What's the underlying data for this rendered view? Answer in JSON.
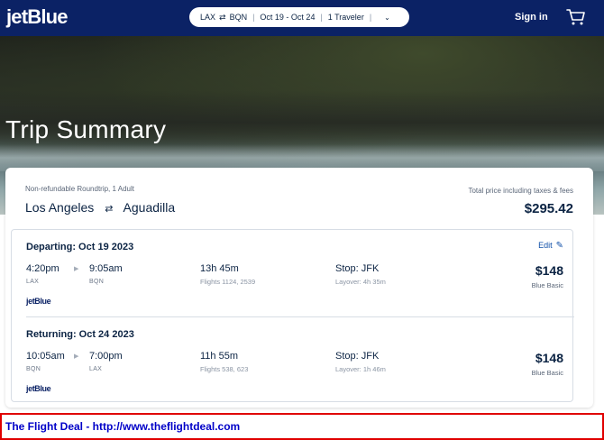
{
  "header": {
    "logo": "jetBlue",
    "search": {
      "origin": "LAX",
      "destination": "BQN",
      "dates": "Oct 19 - Oct 24",
      "travelers": "1 Traveler"
    },
    "signin_label": "Sign in"
  },
  "hero": {
    "title": "Trip Summary"
  },
  "summary": {
    "fare_type": "Non-refundable Roundtrip, 1 Adult",
    "origin_city": "Los Angeles",
    "destination_city": "Aguadilla",
    "total_label": "Total price including taxes & fees",
    "total_price": "$295.42"
  },
  "legs": [
    {
      "title": "Departing: Oct 19 2023",
      "edit_label": "Edit",
      "depart_time": "4:20pm",
      "depart_code": "LAX",
      "arrive_time": "9:05am",
      "arrive_code": "BQN",
      "duration": "13h 45m",
      "flights": "Flights 1124, 2539",
      "stop": "Stop: JFK",
      "layover": "Layover: 4h 35m",
      "price": "$148",
      "fare_class": "Blue Basic",
      "airline_logo": "jetBlue"
    },
    {
      "title": "Returning: Oct 24 2023",
      "depart_time": "10:05am",
      "depart_code": "BQN",
      "arrive_time": "7:00pm",
      "arrive_code": "LAX",
      "duration": "11h 55m",
      "flights": "Flights 538, 623",
      "stop": "Stop: JFK",
      "layover": "Layover: 1h 46m",
      "price": "$148",
      "fare_class": "Blue Basic",
      "airline_logo": "jetBlue"
    }
  ],
  "banner": {
    "text": "The Flight Deal - http://www.theflightdeal.com"
  },
  "icons": {
    "swap": "swap-arrows-icon",
    "chevron": "chevron-down-icon",
    "cart": "cart-icon",
    "edit": "pencil-icon",
    "arrow": "play-arrow-icon"
  },
  "colors": {
    "brand_navy": "#0b2265",
    "text_navy": "#0b2343",
    "link_blue": "#0f4fa8",
    "banner_border": "#e00000",
    "banner_text": "#0000c8"
  }
}
